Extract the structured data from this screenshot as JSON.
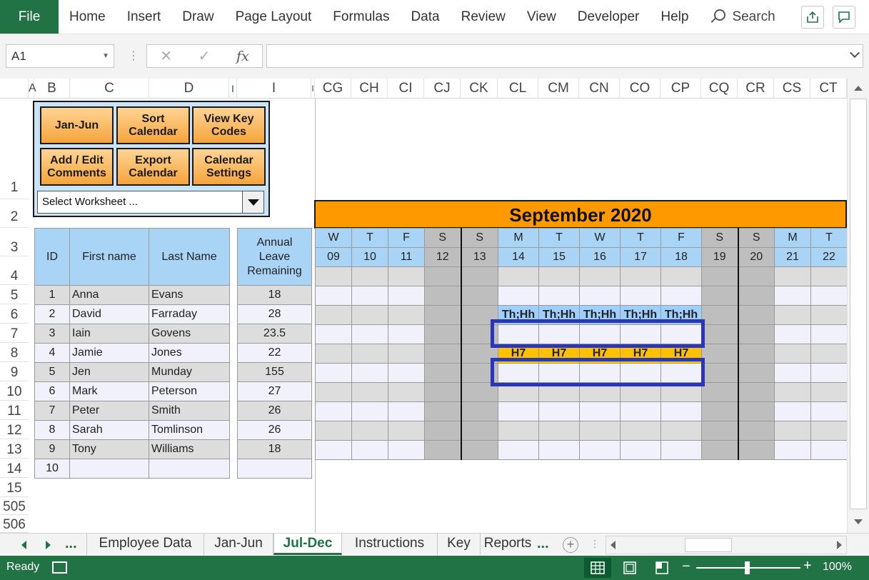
{
  "ribbon": {
    "file_label": "File",
    "tabs": [
      "Home",
      "Insert",
      "Draw",
      "Page Layout",
      "Formulas",
      "Data",
      "Review",
      "View",
      "Developer",
      "Help"
    ],
    "search_label": "Search"
  },
  "formula_bar": {
    "name_box": "A1",
    "fx_label": "fx",
    "formula": ""
  },
  "columns": {
    "left": [
      "A",
      "B",
      "C",
      "D",
      "I",
      "I",
      "I"
    ],
    "right": [
      "CG",
      "CH",
      "CI",
      "CJ",
      "CK",
      "CL",
      "CM",
      "CN",
      "CO",
      "CP",
      "CQ",
      "CR",
      "CS",
      "CT"
    ]
  },
  "rows": [
    "1",
    "2",
    "3",
    "4",
    "5",
    "6",
    "7",
    "8",
    "9",
    "10",
    "11",
    "12",
    "13",
    "14",
    "15",
    "505",
    "506"
  ],
  "panel": {
    "buttons": [
      "Jan-Jun",
      "Sort Calendar",
      "View Key Codes",
      "Add / Edit Comments",
      "Export Calendar",
      "Calendar Settings"
    ],
    "select_text": "Select Worksheet ..."
  },
  "employees": {
    "headers": {
      "id": "ID",
      "first": "First name",
      "last": "Last Name",
      "leave": "Annual Leave Remaining"
    },
    "rows": [
      {
        "id": "1",
        "first": "Anna",
        "last": "Evans",
        "leave": "18"
      },
      {
        "id": "2",
        "first": "David",
        "last": "Farraday",
        "leave": "28"
      },
      {
        "id": "3",
        "first": "Iain",
        "last": "Govens",
        "leave": "23.5"
      },
      {
        "id": "4",
        "first": "Jamie",
        "last": "Jones",
        "leave": "22"
      },
      {
        "id": "5",
        "first": "Jen",
        "last": "Munday",
        "leave": "155"
      },
      {
        "id": "6",
        "first": "Mark",
        "last": "Peterson",
        "leave": "27"
      },
      {
        "id": "7",
        "first": "Peter",
        "last": "Smith",
        "leave": "26"
      },
      {
        "id": "8",
        "first": "Sarah",
        "last": "Tomlinson",
        "leave": "26"
      },
      {
        "id": "9",
        "first": "Tony",
        "last": "Williams",
        "leave": "18"
      },
      {
        "id": "10",
        "first": "",
        "last": "",
        "leave": ""
      }
    ]
  },
  "calendar": {
    "title": "September 2020",
    "weekdays": [
      "W",
      "T",
      "F",
      "S",
      "S",
      "M",
      "T",
      "W",
      "T",
      "F",
      "S",
      "S",
      "M",
      "T"
    ],
    "days": [
      "09",
      "10",
      "11",
      "12",
      "13",
      "14",
      "15",
      "16",
      "17",
      "18",
      "19",
      "20",
      "21",
      "22"
    ],
    "entries": {
      "row3": [
        "",
        "",
        "",
        "",
        "",
        "Th;Hh",
        "Th;Hh",
        "Th;Hh",
        "Th;Hh",
        "Th;Hh",
        "",
        "",
        "",
        ""
      ],
      "row5": [
        "",
        "",
        "",
        "",
        "",
        "H7",
        "H7",
        "H7",
        "H7",
        "H7",
        "",
        "",
        "",
        ""
      ]
    },
    "colors": {
      "weekend": "#bebebe",
      "highlight_blue": "#9ecfff",
      "highlight_gold": "#ffc000",
      "title_bg": "#ff9900",
      "box_border": "#2a36b8"
    }
  },
  "sheet_tabs": {
    "more": "...",
    "tabs": [
      "Employee Data",
      "Jan-Jun",
      "Jul-Dec",
      "Instructions",
      "Key",
      "Reports"
    ],
    "active": "Jul-Dec"
  },
  "status": {
    "ready": "Ready",
    "zoom": "100%",
    "zoom_minus": "−",
    "zoom_plus": "+"
  },
  "theme": {
    "accent": "#217346"
  }
}
